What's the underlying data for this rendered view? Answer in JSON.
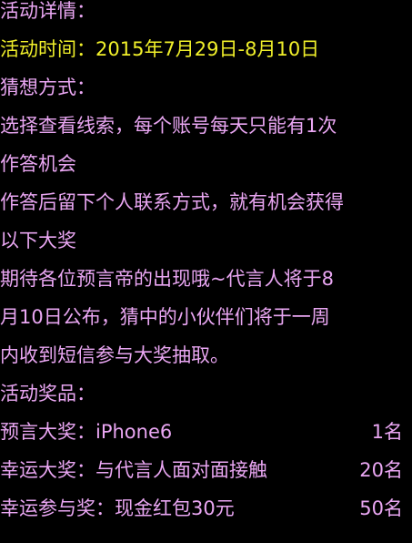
{
  "colors": {
    "background": "#000000",
    "text": "#e9a6f2",
    "highlight": "#f0ef2a"
  },
  "activity": {
    "details_title": "活动详情：",
    "time_label": "活动时间：",
    "time_value": "2015年7月29日-8月10日",
    "method_title": "猜想方式：",
    "method_line1": "选择查看线索，每个账号每天只能有1次",
    "method_line2": "作答机会",
    "method_line3": "作答后留下个人联系方式，就有机会获得",
    "method_line4": "以下大奖",
    "method_line5": "期待各位预言帝的出现哦~代言人将于8",
    "method_line6": "月10日公布，猜中的小伙伴们将于一周",
    "method_line7": "内收到短信参与大奖抽取。",
    "prizes_title": "活动奖品：",
    "prizes": [
      {
        "name": "预言大奖：iPhone6",
        "quantity": "1名"
      },
      {
        "name": "幸运大奖：与代言人面对面接触",
        "quantity": "20名"
      },
      {
        "name": "幸运参与奖：现金红包30元",
        "quantity": "50名"
      }
    ]
  }
}
